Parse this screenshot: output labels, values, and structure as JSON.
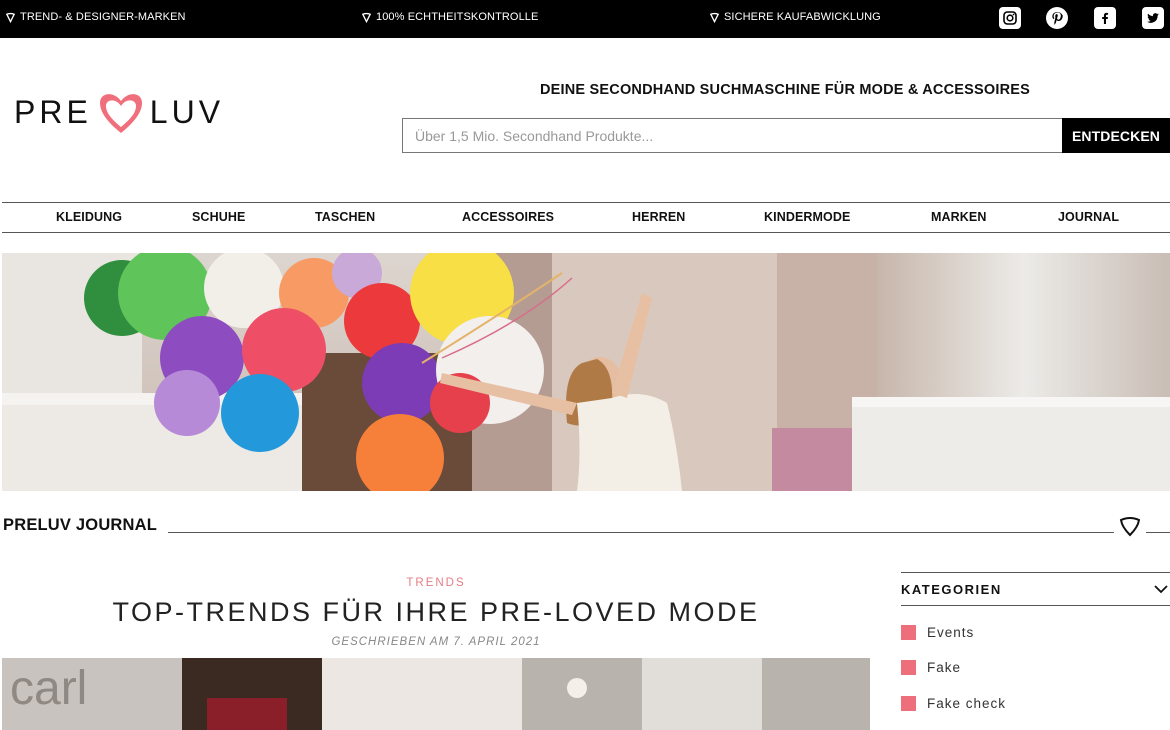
{
  "topbar": {
    "items": [
      "TREND- & DESIGNER-MARKEN",
      "100% ECHTHEITSKONTROLLE",
      "SICHERE KAUFABWICKLUNG"
    ],
    "social": [
      "instagram-icon",
      "pinterest-icon",
      "facebook-icon",
      "twitter-icon"
    ]
  },
  "header": {
    "logo_left": "PRE",
    "logo_right": "LUV",
    "tagline": "DEINE SECONDHAND SUCHMASCHINE FÜR MODE & ACCESSOIRES",
    "search_placeholder": "Über 1,5 Mio. Secondhand Produkte...",
    "search_button": "ENTDECKEN"
  },
  "nav": {
    "items": [
      "KLEIDUNG",
      "SCHUHE",
      "TASCHEN",
      "ACCESSOIRES",
      "HERREN",
      "KINDERMODE",
      "MARKEN",
      "JOURNAL"
    ]
  },
  "journal": {
    "title": "PRELUV JOURNAL"
  },
  "article": {
    "category": "TRENDS",
    "title": "TOP-TRENDS FÜR IHRE PRE-LOVED MODE",
    "meta": "GESCHRIEBEN AM 7. APRIL 2021"
  },
  "sidebar": {
    "title": "KATEGORIEN",
    "items": [
      "Events",
      "Fake",
      "Fake check"
    ]
  },
  "colors": {
    "accent": "#ee6f7c",
    "topbar_bg": "#000000"
  }
}
